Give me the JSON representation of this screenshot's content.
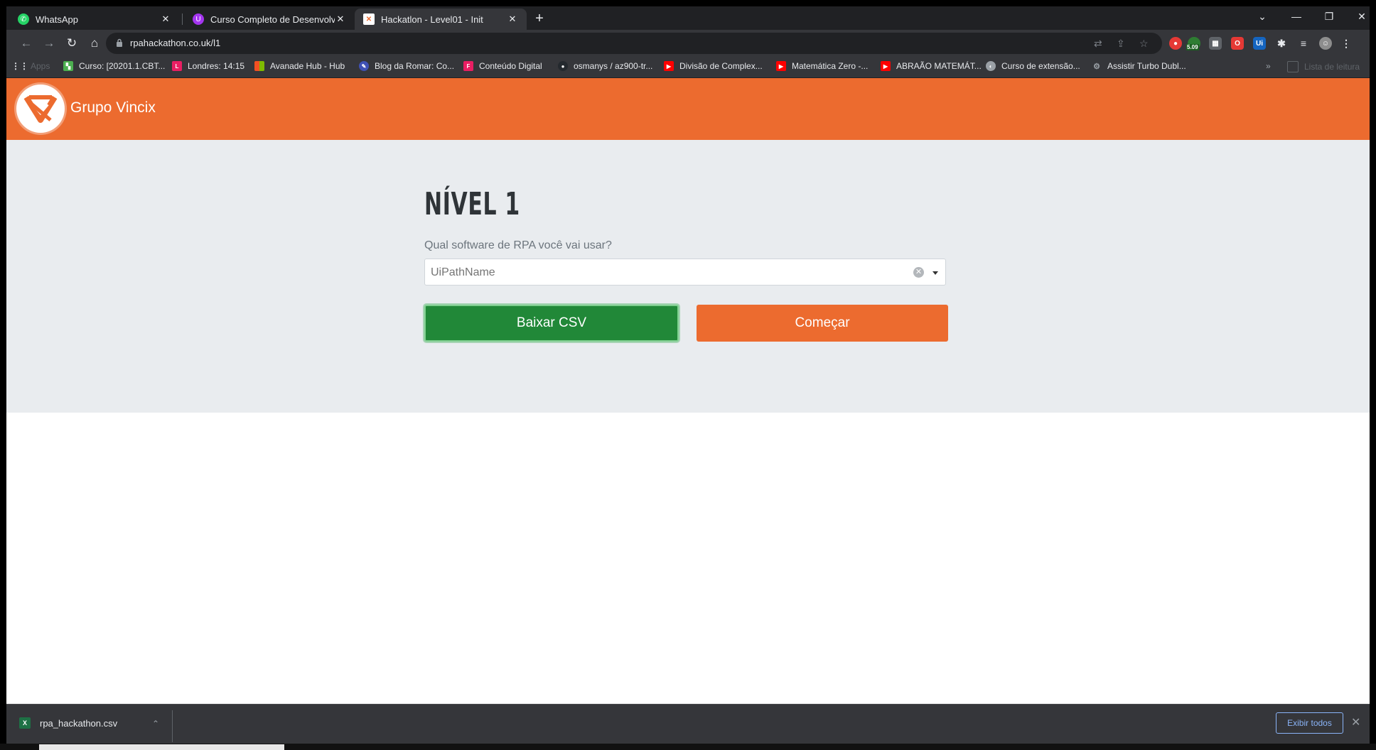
{
  "browser": {
    "tabs": [
      {
        "title": "WhatsApp",
        "icon": "whatsapp-icon",
        "color": "#25d366"
      },
      {
        "title": "Curso Completo de Desenvolved",
        "icon": "udemy-icon",
        "color": "#a435f0"
      },
      {
        "title": "Hackatlon - Level01 - Init",
        "icon": "vincix-icon",
        "color": "#ec6b2f"
      }
    ],
    "url": "rpahackathon.co.uk/l1",
    "bookmarks": [
      {
        "label": "Apps",
        "icon": "apps-grid-icon",
        "color": "#e8eaed"
      },
      {
        "label": "Curso: [20201.1.CBT...",
        "icon": "course-icon",
        "color": "#4caf50"
      },
      {
        "label": "Londres: 14:15",
        "icon": "calendar-icon",
        "color": "#e91e63"
      },
      {
        "label": "Avanade Hub - Hub",
        "icon": "microsoft-icon",
        "color": "#f25022"
      },
      {
        "label": "Blog da Romar: Co...",
        "icon": "blog-icon",
        "color": "#3f51b5"
      },
      {
        "label": "Conteúdo Digital",
        "icon": "content-icon",
        "color": "#e91e63"
      },
      {
        "label": "osmanys / az900-tr...",
        "icon": "github-icon",
        "color": "#24292e"
      },
      {
        "label": "Divisão de Complex...",
        "icon": "youtube-icon",
        "color": "#ff0000"
      },
      {
        "label": "Matemática Zero -...",
        "icon": "youtube-icon",
        "color": "#ff0000"
      },
      {
        "label": "ABRAÃO MATEMÁT...",
        "icon": "youtube-icon",
        "color": "#ff0000"
      },
      {
        "label": "Curso de extensão...",
        "icon": "globe-icon",
        "color": "#9aa0a6"
      },
      {
        "label": "Assistir Turbo Dubl...",
        "icon": "turbo-icon",
        "color": "#9aa0a6"
      }
    ],
    "reading_list": "Lista de leitura",
    "extension_badge": "5.09"
  },
  "site": {
    "brand": "Grupo Vincix",
    "brand_color": "#ec6b2f",
    "level_title": "NÍVEL 1",
    "question": "Qual software de RPA você vai usar?",
    "select_value": "UiPathName",
    "btn_download": "Baixar CSV",
    "btn_start": "Começar",
    "btn_download_color": "#218838"
  },
  "downloads": {
    "file": "rpa_hackathon.csv",
    "show_all": "Exibir todos"
  }
}
